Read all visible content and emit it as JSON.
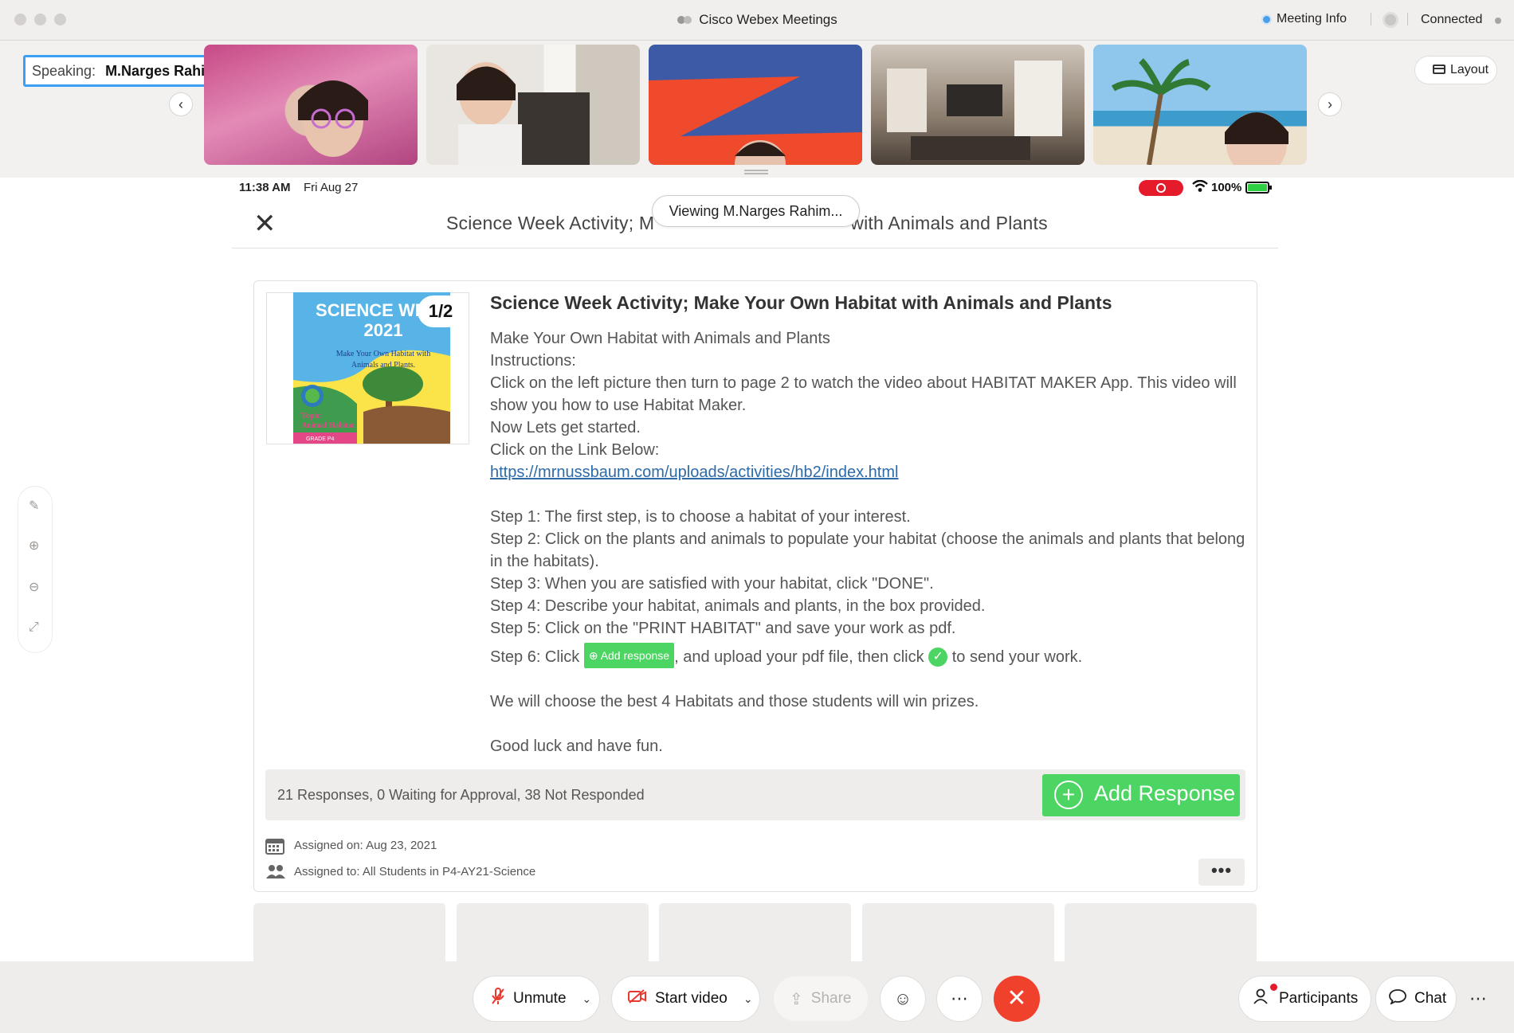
{
  "window": {
    "title": "Cisco Webex Meetings",
    "meeting_info": "Meeting Info",
    "status": "Connected"
  },
  "video_strip": {
    "speaking_label": "Speaking:",
    "speaking_name": "M.Narges Rahimiparvar (C...",
    "layout_label": "Layout"
  },
  "device_status": {
    "time": "11:38 AM",
    "date": "Fri Aug 27",
    "battery": "100%"
  },
  "viewing_banner": "Viewing M.Narges Rahim...",
  "document": {
    "title_left": "Science Week Activity; M",
    "title_right": "with Animals and Plants",
    "page_indicator": "1/2",
    "cover": {
      "line1": "SCIENCE WEEK",
      "line2": "2021",
      "subtitle": "Make Your Own Habitat with Animals and Plants",
      "topic": "Topic: Animal Habitat",
      "grade": "GRADE P4"
    },
    "heading": "Science Week Activity; Make Your Own Habitat with Animals and Plants",
    "intro_1": "Make Your Own Habitat with Animals and Plants",
    "intro_2": "Instructions:",
    "intro_3": "Click on the left picture then turn to page 2 to watch the video about HABITAT MAKER App. This video will show you how to use Habitat Maker.",
    "intro_4": "Now Lets get started.",
    "intro_5": "Click on the Link Below:",
    "link": "https://mrnussbaum.com/uploads/activities/hb2/index.html",
    "step1": "Step 1: The first step, is to choose a habitat of your interest.",
    "step2": "Step 2: Click on the plants and animals to populate your habitat (choose the animals and plants that belong in the habitats).",
    "step3": "Step 3: When you are satisfied with your habitat, click \"DONE\".",
    "step4": "Step 4: Describe your habitat, animals and plants, in the box provided.",
    "step5": "Step 5: Click on the \"PRINT HABITAT\" and save your work as pdf.",
    "step6_a": "Step 6: Click",
    "step6_btn": "Add response",
    "step6_b": ", and upload your pdf file, then click",
    "step6_c": "to send your work.",
    "closing_1": "We will choose the best 4 Habitats and those students will win prizes.",
    "closing_2": "Good luck and have fun.",
    "responses_summary": "21 Responses, 0 Waiting for Approval, 38 Not Responded",
    "add_response_label": "Add Response",
    "assigned_on": "Assigned on: Aug 23, 2021",
    "assigned_to": "Assigned to: All Students in P4-AY21-Science"
  },
  "controls": {
    "unmute": "Unmute",
    "start_video": "Start video",
    "share": "Share",
    "participants": "Participants",
    "chat": "Chat"
  },
  "colors": {
    "accent_green": "#4cd562",
    "end_red": "#f0412d",
    "speaking_blue": "#3aa0f5",
    "link_blue": "#2d6aa8"
  }
}
